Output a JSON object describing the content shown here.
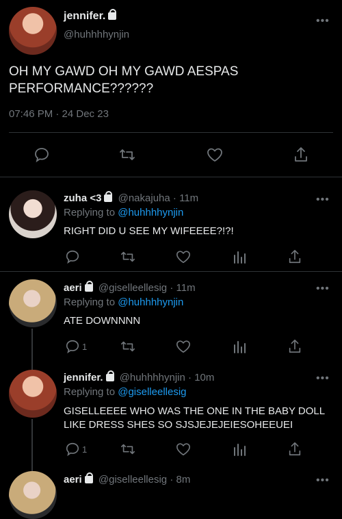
{
  "main_tweet": {
    "display_name": "jennifer.",
    "handle": "@huhhhhynjin",
    "text_line1": "OH MY GAWD OH MY GAWD AESPAS",
    "text_line2": "PERFORMANCE??????",
    "timestamp": "07:46 PM · 24 Dec 23"
  },
  "replies": [
    {
      "display_name": "zuha <3",
      "handle": "@nakajuha",
      "time": "11m",
      "replying_label": "Replying to",
      "replying_to": "@huhhhhynjin",
      "text": "RIGHT DID U SEE MY WIFEEEE?!?!",
      "reply_count": ""
    },
    {
      "display_name": "aeri",
      "handle": "@giselleellesig",
      "time": "11m",
      "replying_label": "Replying to",
      "replying_to": "@huhhhhynjin",
      "text": "ATE DOWNNNN",
      "reply_count": "1"
    },
    {
      "display_name": "jennifer.",
      "handle": "@huhhhhynjin",
      "time": "10m",
      "replying_label": "Replying to",
      "replying_to": "@giselleellesig",
      "text_line1": "GISELLEEEE WHO WAS THE ONE IN THE BABY DOLL",
      "text_line2": "LIKE DRESS SHES SO SJSJEJEJEIESOHEEUEI",
      "reply_count": "1"
    },
    {
      "display_name": "aeri",
      "handle": "@giselleellesig",
      "time": "8m"
    }
  ],
  "dot_sep": " · ",
  "icons": [
    "reply-icon",
    "retweet-icon",
    "like-icon",
    "analytics-icon",
    "share-icon",
    "lock-icon",
    "more-icon"
  ],
  "colors": {
    "background": "#000000",
    "text": "#e7e9ea",
    "muted": "#71767b",
    "link": "#1d9bf0"
  }
}
